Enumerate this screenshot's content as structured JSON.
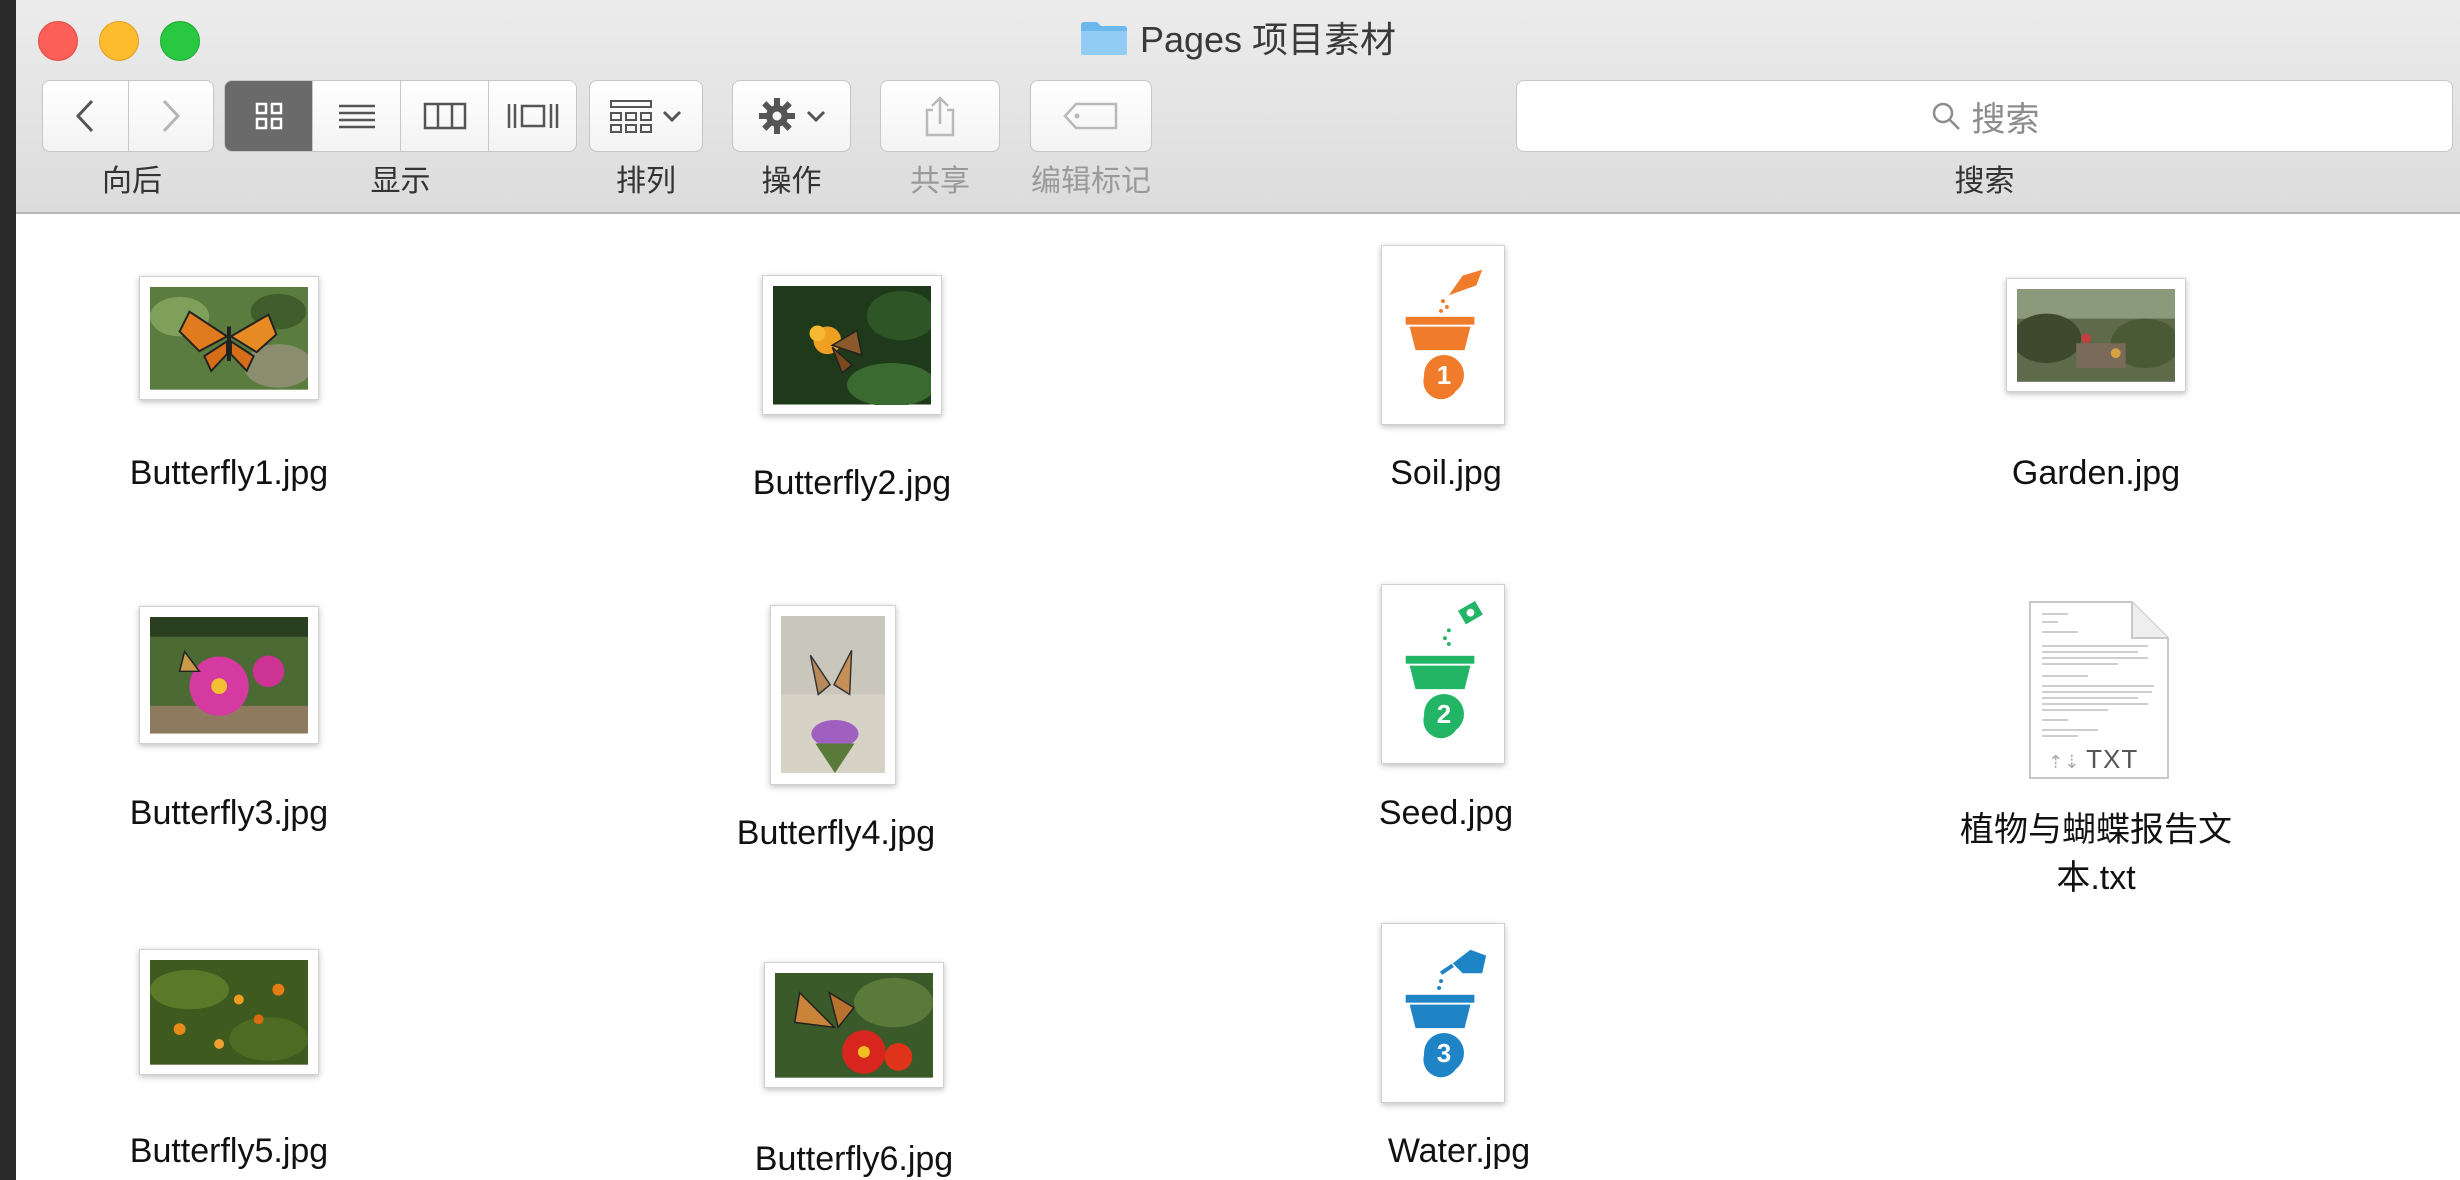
{
  "window": {
    "title": "Pages 项目素材"
  },
  "toolbar": {
    "back_label": "向后",
    "view_label": "显示",
    "arrange_label": "排列",
    "action_label": "操作",
    "share_label": "共享",
    "tags_label": "编辑标记",
    "search_label": "搜索",
    "search_placeholder": "搜索"
  },
  "files": [
    {
      "name": "Butterfly1.jpg"
    },
    {
      "name": "Butterfly2.jpg"
    },
    {
      "name": "Soil.jpg",
      "step": "1",
      "color": "#f07b2a"
    },
    {
      "name": "Garden.jpg"
    },
    {
      "name": "Butterfly3.jpg"
    },
    {
      "name": "Butterfly4.jpg"
    },
    {
      "name": "Seed.jpg",
      "step": "2",
      "color": "#22b566"
    },
    {
      "name": "植物与蝴蝶报告文本.txt",
      "badge": "TXT"
    },
    {
      "name": "Butterfly5.jpg"
    },
    {
      "name": "Butterfly6.jpg"
    },
    {
      "name": "Water.jpg",
      "step": "3",
      "color": "#1f84c6"
    }
  ]
}
